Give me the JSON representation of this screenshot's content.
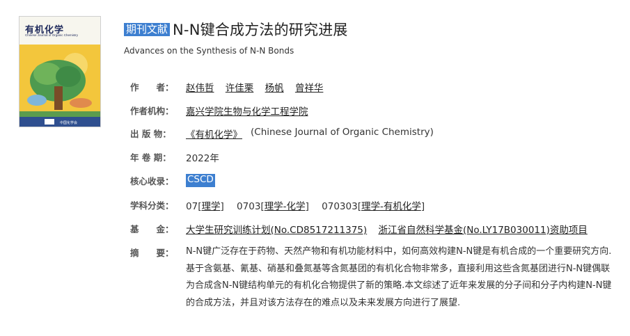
{
  "cover": {
    "title": "有机化学",
    "subtitle": "Chinese Journal of Organic Chemistry"
  },
  "article": {
    "tag": "期刊文献",
    "title": "N-N键合成方法的研究进展",
    "subtitle": "Advances on the Synthesis of N-N Bonds"
  },
  "fields": {
    "authors": {
      "label": "作　　者：",
      "items": [
        "赵伟哲",
        "许佳栗",
        "杨帆",
        "曾祥华"
      ]
    },
    "institution": {
      "label": "作者机构：",
      "value": "嘉兴学院生物与化学工程学院"
    },
    "publication": {
      "label": "出 版 物：",
      "value": "《有机化学》",
      "english": "(Chinese Journal of Organic Chemistry)"
    },
    "year": {
      "label": "年 卷 期：",
      "value": "2022年"
    },
    "core": {
      "label": "核心收录：",
      "value": "CSCD"
    },
    "subject": {
      "label": "学科分类：",
      "items": [
        {
          "code": "07",
          "name": "理学"
        },
        {
          "code": "0703",
          "name": "理学-化学"
        },
        {
          "code": "070303",
          "name": "理学-有机化学"
        }
      ]
    },
    "fund": {
      "label": "基　　金：",
      "items": [
        "大学生研究训练计划(No.CD8517211375)",
        "浙江省自然科学基金(No.LY17B030011)资助项目"
      ]
    },
    "abstract": {
      "label": "摘　　要：",
      "value": "N-N键广泛存在于药物、天然产物和有机功能材料中，如何高效构建N-N键是有机合成的一个重要研究方向.基于含氨基、氰基、硝基和叠氮基等含氮基团的有机化合物非常多，直接利用这些含氮基团进行N-N键偶联为合成含N-N键结构单元的有机化合物提供了新的策略.本文综述了近年来发展的分子间和分子内构建N-N键的合成方法，并且对该方法存在的难点以及未来发展方向进行了展望."
    }
  }
}
